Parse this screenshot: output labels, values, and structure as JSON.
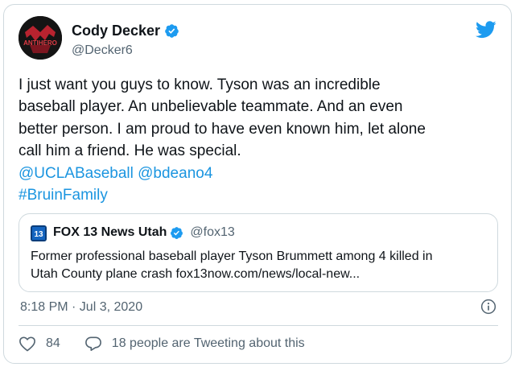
{
  "author": {
    "name": "Cody Decker",
    "handle": "@Decker6",
    "avatar_text": "ANTIHERO"
  },
  "tweet": {
    "lines": [
      "I just want you guys to know. Tyson was an incredible",
      "baseball player. An unbelievable teammate. And an even",
      "better person. I am proud to have even known him, let alone",
      "call him a friend. He was special."
    ],
    "mentions": [
      "@UCLABaseball",
      "@bdeano4"
    ],
    "hashtag": "#BruinFamily"
  },
  "quote": {
    "name": "FOX 13 News Utah",
    "handle": "@fox13",
    "logo_text": "13",
    "lines": [
      "Former professional baseball player Tyson Brummett among 4 killed in",
      "Utah County plane crash fox13now.com/news/local-new..."
    ]
  },
  "timestamp": "8:18 PM · Jul 3, 2020",
  "actions": {
    "likes": "84",
    "reply_text": "18 people are Tweeting about this"
  },
  "colors": {
    "link": "#1b95e0",
    "verified": "#1d9bf0",
    "muted": "#536471",
    "border": "#cfd9de"
  },
  "icons": [
    "verified-badge-icon",
    "twitter-bird-icon",
    "info-icon",
    "heart-icon",
    "reply-bubble-icon"
  ]
}
